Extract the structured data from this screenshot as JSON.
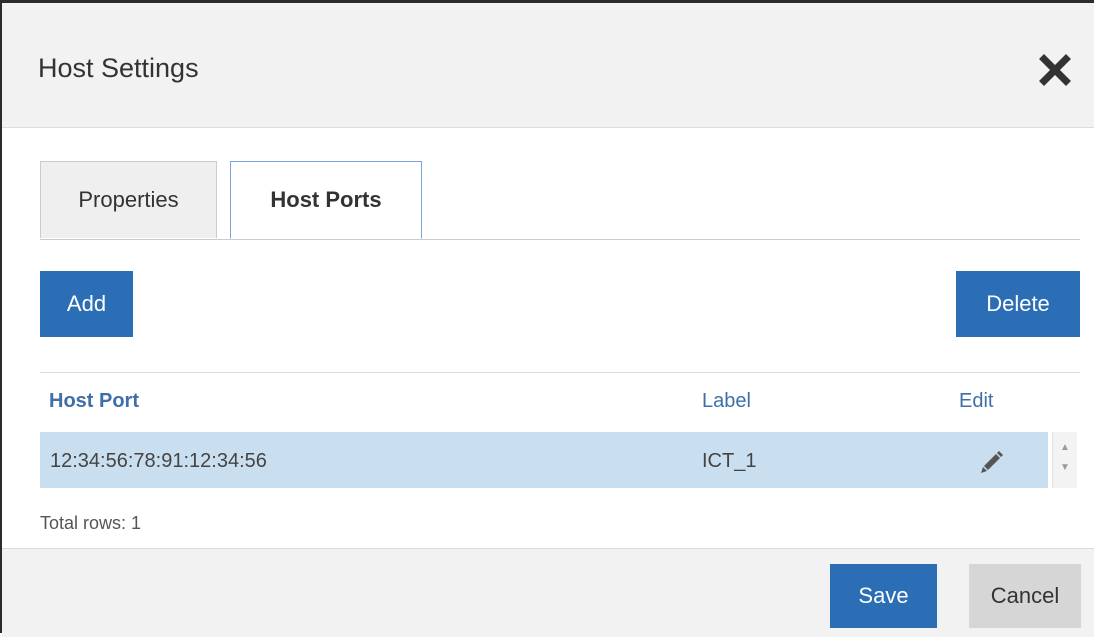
{
  "dialog": {
    "title": "Host Settings",
    "close_icon": "close-icon"
  },
  "tabs": [
    {
      "label": "Properties",
      "active": false
    },
    {
      "label": "Host Ports",
      "active": true
    }
  ],
  "toolbar": {
    "add_label": "Add",
    "delete_label": "Delete"
  },
  "table": {
    "columns": [
      "Host Port",
      "Label",
      "Edit"
    ],
    "rows": [
      {
        "host_port": "12:34:56:78:91:12:34:56",
        "label": "ICT_1",
        "edit_icon": "pencil-icon"
      }
    ],
    "total_rows_text": "Total rows: 1"
  },
  "footer": {
    "save_label": "Save",
    "cancel_label": "Cancel"
  },
  "colors": {
    "primary": "#2c6eb5",
    "row_selected": "#c9dff0",
    "header_text": "#3f6ea8"
  }
}
